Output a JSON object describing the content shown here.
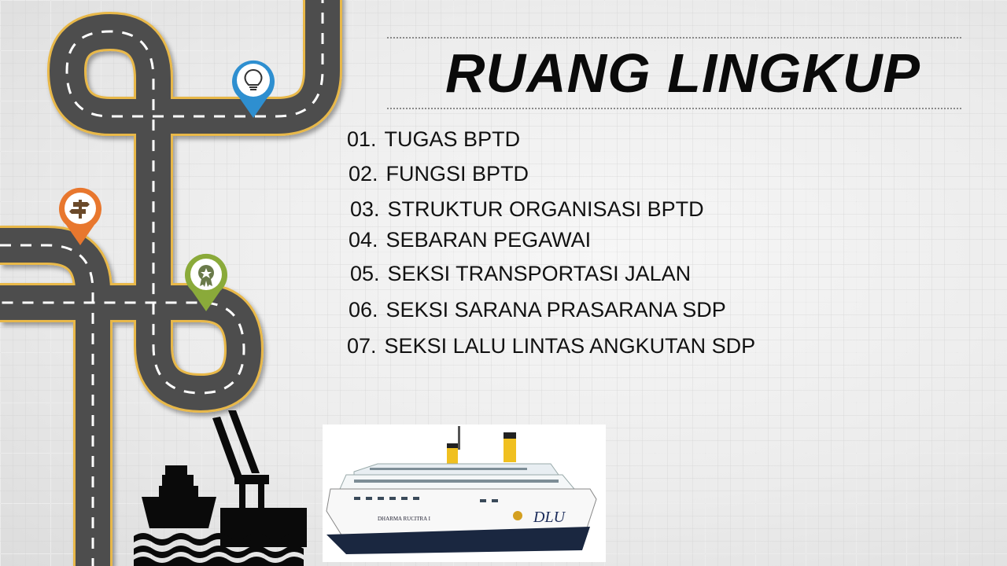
{
  "slide": {
    "title": "RUANG LINGKUP",
    "items": [
      {
        "num": "01.",
        "label": "TUGAS BPTD"
      },
      {
        "num": "02.",
        "label": "FUNGSI BPTD"
      },
      {
        "num": "03.",
        "label": "STRUKTUR ORGANISASI BPTD"
      },
      {
        "num": "04.",
        "label": "SEBARAN PEGAWAI"
      },
      {
        "num": "05.",
        "label": "SEKSI TRANSPORTASI JALAN"
      },
      {
        "num": "06.",
        "label": "SEKSI SARANA PRASARANA SDP"
      },
      {
        "num": "07.",
        "label": "SEKSI LALU LINTAS ANGKUTAN SDP"
      }
    ],
    "ship_name": "DLU",
    "ship_side_text": "DHARMA RUCITRA I",
    "pins": [
      {
        "icon": "lightbulb-icon",
        "color": "#2e8fd0"
      },
      {
        "icon": "signpost-icon",
        "color": "#e8772e"
      },
      {
        "icon": "award-badge-icon",
        "color": "#8aaa3a"
      }
    ]
  }
}
